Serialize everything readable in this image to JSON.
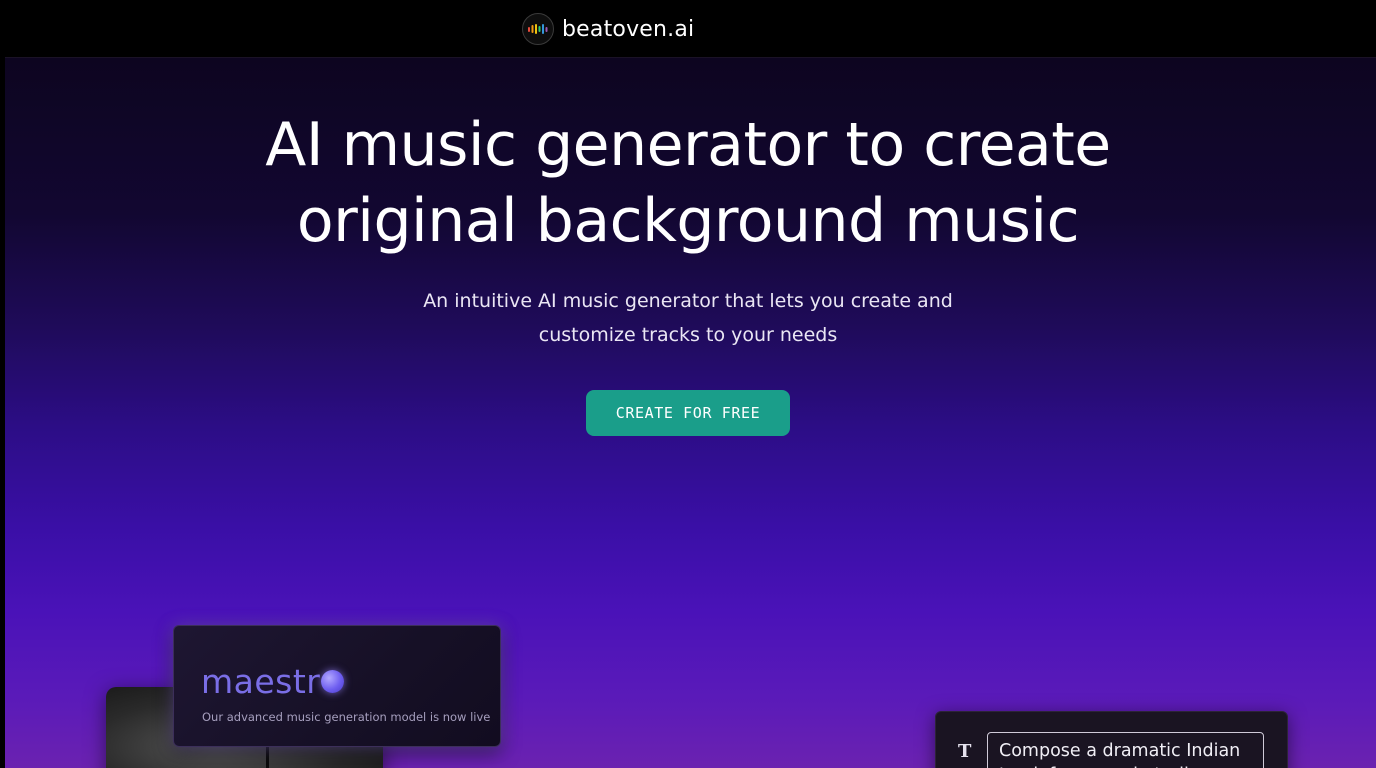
{
  "nav": {
    "logo_text": "beatoven.ai",
    "logo_icon": "equalizer-bars-icon"
  },
  "hero": {
    "title_line1": "AI music generator to create",
    "title_line2": "original background music",
    "subtitle_line1": "An intuitive AI music generator that lets you create and",
    "subtitle_line2": "customize tracks to your needs",
    "cta_label": "CREATE FOR FREE"
  },
  "maestro_card": {
    "name_prefix": "maestr",
    "description": "Our advanced music generation model is now live"
  },
  "prompt_card": {
    "icon": "text-type-icon",
    "icon_glyph": "T",
    "prompt_text": "Compose a dramatic Indian track for a movie trailer"
  },
  "colors": {
    "cta": "#1a9e8a",
    "maestro_accent": "#7a6ee6",
    "background_top": "#0d0520",
    "background_bottom": "#6b22b0"
  }
}
